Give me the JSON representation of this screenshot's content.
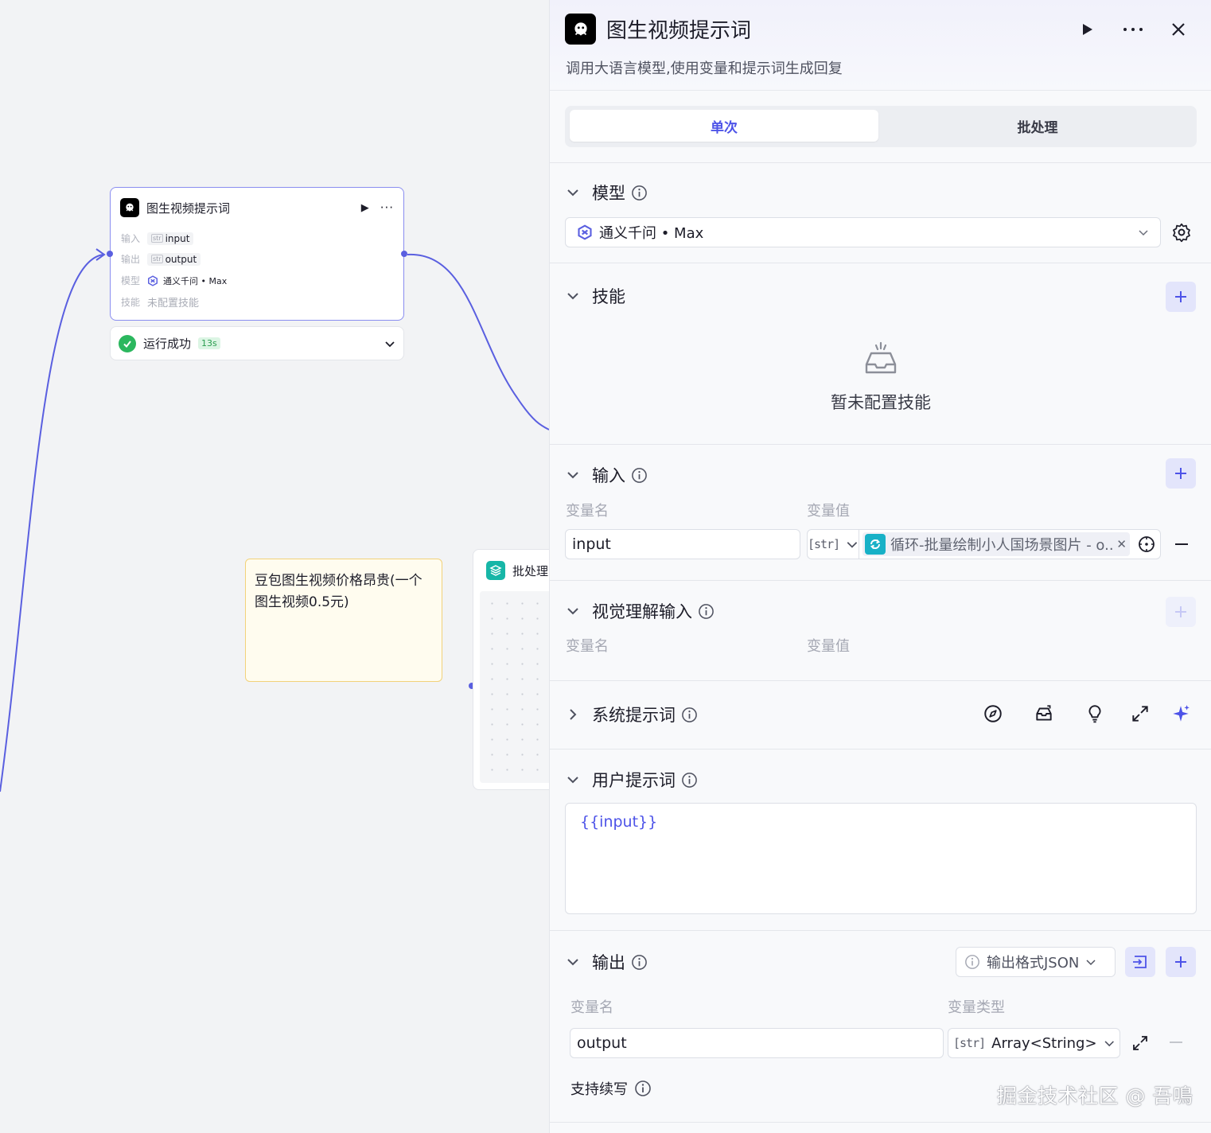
{
  "canvas": {
    "llm_node": {
      "title": "图生视频提示词",
      "input_key": "输入",
      "input_type": "str",
      "input_value": "input",
      "output_key": "输出",
      "output_type": "str",
      "output_value": "output",
      "model_key": "模型",
      "model_value": "通义千问 • Max",
      "skill_key": "技能",
      "skill_value": "未配置技能"
    },
    "status": {
      "text": "运行成功",
      "time": "13s"
    },
    "note": {
      "text": "豆包图生视频价格昂贵(一个图生视频0.5元)"
    },
    "batch_node": {
      "title": "批处理"
    }
  },
  "panel": {
    "title": "图生视频提示词",
    "subtitle": "调用大语言模型,使用变量和提示词生成回复",
    "tabs": [
      "单次",
      "批处理"
    ],
    "model": {
      "label": "模型",
      "selected": "通义千问 • Max"
    },
    "skills": {
      "label": "技能",
      "empty_text": "暂未配置技能"
    },
    "input": {
      "label": "输入",
      "col_name": "变量名",
      "col_value": "变量值",
      "name_value": "input",
      "type": "str",
      "ref_text": "循环-批量绘制小人国场景图片 - o..."
    },
    "vision_input": {
      "label": "视觉理解输入",
      "col_name": "变量名",
      "col_value": "变量值"
    },
    "system_prompt": {
      "label": "系统提示词"
    },
    "user_prompt": {
      "label": "用户提示词",
      "value": "{{input}}"
    },
    "output": {
      "label": "输出",
      "format": "输出格式JSON",
      "col_name": "变量名",
      "col_type": "变量类型",
      "name_value": "output",
      "type_tag": "str",
      "type_value": "Array<String>",
      "continue_label": "支持续写"
    },
    "watermark": "掘金技术社区 @ 吾鳴"
  },
  "colors": {
    "accent": "#4d53e8",
    "success": "#2bb75e",
    "edge": "#5a5fe0",
    "note_bg": "#fffcef",
    "note_border": "#f2d27a",
    "loop_icon": "#18b1c7",
    "batch_icon": "#17b6a7"
  }
}
